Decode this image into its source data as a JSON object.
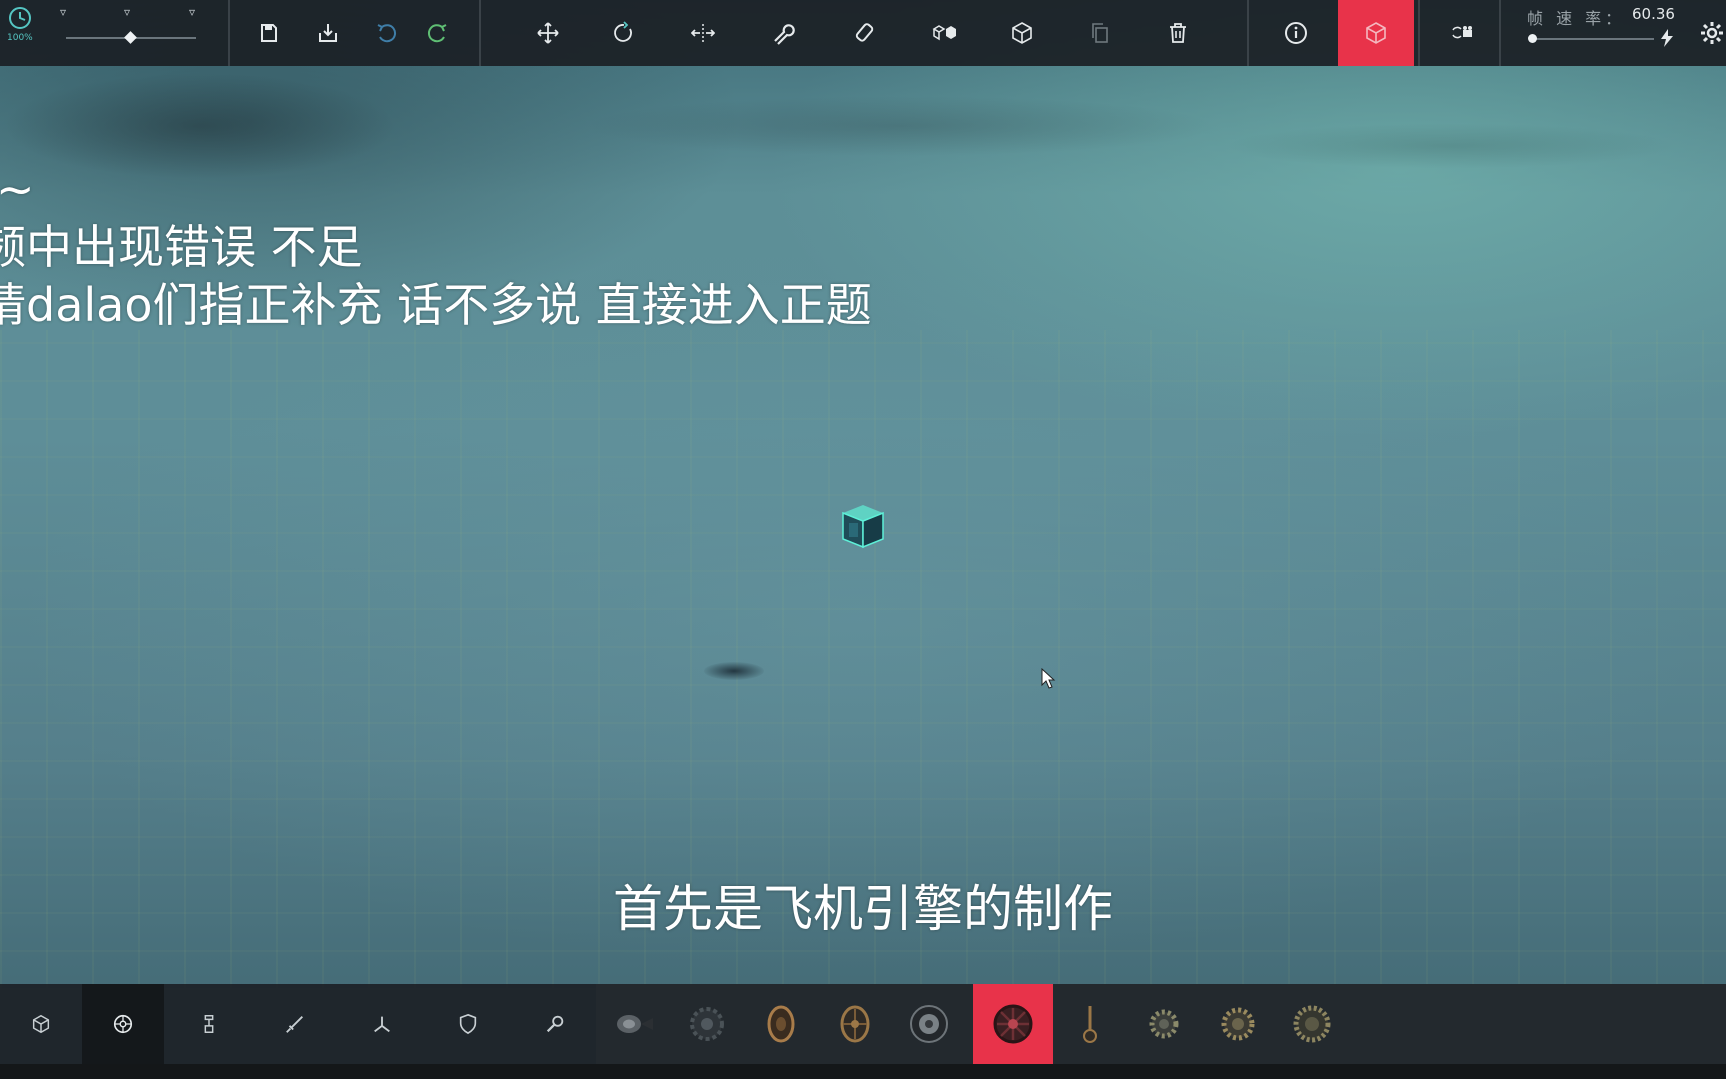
{
  "topbar": {
    "time_scale": "100%",
    "fps_label": "帧 速 率：",
    "fps_value": "60.36",
    "tools": [
      {
        "name": "save-icon"
      },
      {
        "name": "load-icon"
      },
      {
        "name": "undo-icon"
      },
      {
        "name": "redo-icon"
      },
      {
        "name": "translate-icon"
      },
      {
        "name": "rotate-icon"
      },
      {
        "name": "mirror-icon"
      },
      {
        "name": "wrench-icon"
      },
      {
        "name": "eraser-icon"
      },
      {
        "name": "blocks-icon"
      },
      {
        "name": "box-icon"
      },
      {
        "name": "copy-icon"
      },
      {
        "name": "trash-icon"
      },
      {
        "name": "info-icon"
      },
      {
        "name": "build-mode-icon"
      },
      {
        "name": "camera-icon"
      },
      {
        "name": "settings-icon"
      }
    ],
    "accent_color": "#e8334a",
    "teal_color": "#55c6c3"
  },
  "overlay": {
    "lines": [
      "吧~",
      "频中出现错误 不足",
      "请dalao们指正补充 话不多说 直接进入正题"
    ],
    "caption": "首先是飞机引擎的制作"
  },
  "bottombar": {
    "categories": [
      {
        "name": "blocks-category-icon"
      },
      {
        "name": "wheels-category-icon"
      },
      {
        "name": "mechanical-category-icon"
      },
      {
        "name": "weapons-category-icon"
      },
      {
        "name": "aero-category-icon"
      },
      {
        "name": "armor-category-icon"
      },
      {
        "name": "utility-category-icon"
      }
    ],
    "selected_category": 1,
    "parts": [
      {
        "name": "motor-wheel-part"
      },
      {
        "name": "large-gear-part"
      },
      {
        "name": "wooden-wheel-part"
      },
      {
        "name": "small-wheel-part"
      },
      {
        "name": "tire-wheel-part"
      },
      {
        "name": "red-wheel-part"
      },
      {
        "name": "crank-part"
      },
      {
        "name": "small-cog-part"
      },
      {
        "name": "medium-cog-part"
      },
      {
        "name": "large-cog-part"
      }
    ],
    "selected_part": 5
  }
}
